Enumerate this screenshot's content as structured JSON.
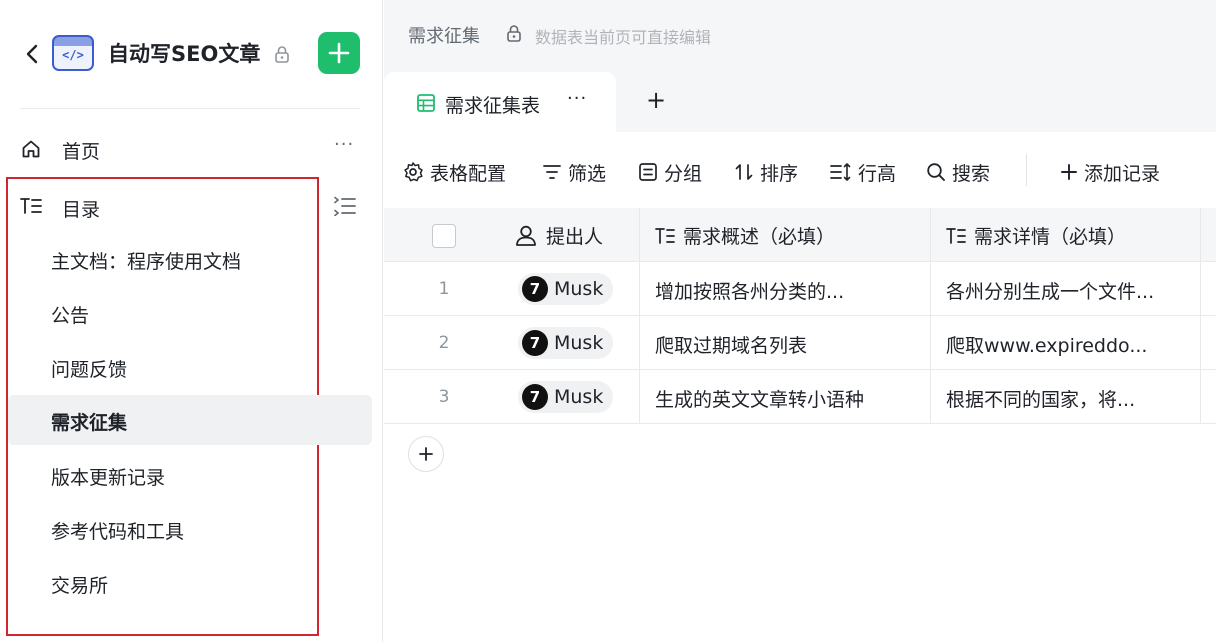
{
  "sidebar": {
    "app_title": "自动写SEO文章",
    "app_icon_code": "</>",
    "home_label": "首页",
    "home_more": "···",
    "catalog_label": "目录",
    "items": [
      {
        "label": "主文档：程序使用文档"
      },
      {
        "label": "公告"
      },
      {
        "label": "问题反馈"
      },
      {
        "label": "需求征集"
      },
      {
        "label": "版本更新记录"
      },
      {
        "label": "参考代码和工具"
      },
      {
        "label": "交易所"
      }
    ],
    "active_item": "需求征集",
    "colors": {
      "add_button": "#1fbe6c",
      "highlight_box": "#d0262e",
      "app_icon": "#3b5ccc"
    }
  },
  "header": {
    "breadcrumb": "需求征集",
    "lock_note": "数据表当前页可直接编辑"
  },
  "tabs": {
    "active_label": "需求征集表",
    "more": "···",
    "add": "+"
  },
  "toolbar": {
    "config": "表格配置",
    "filter": "筛选",
    "group": "分组",
    "sort": "排序",
    "row_height": "行高",
    "search": "搜索",
    "add_record": "添加记录"
  },
  "table": {
    "columns": [
      "提出人",
      "需求概述（必填）",
      "需求详情（必填）"
    ],
    "rows": [
      {
        "num": "1",
        "person": "Musk",
        "avatar_text": "7",
        "summary": "增加按照各州分类的...",
        "detail": "各州分别生成一个文件..."
      },
      {
        "num": "2",
        "person": "Musk",
        "avatar_text": "7",
        "summary": "爬取过期域名列表",
        "detail": "爬取www.expireddo..."
      },
      {
        "num": "3",
        "person": "Musk",
        "avatar_text": "7",
        "summary": "生成的英文文章转小语种",
        "detail": "根据不同的国家，将..."
      }
    ]
  }
}
